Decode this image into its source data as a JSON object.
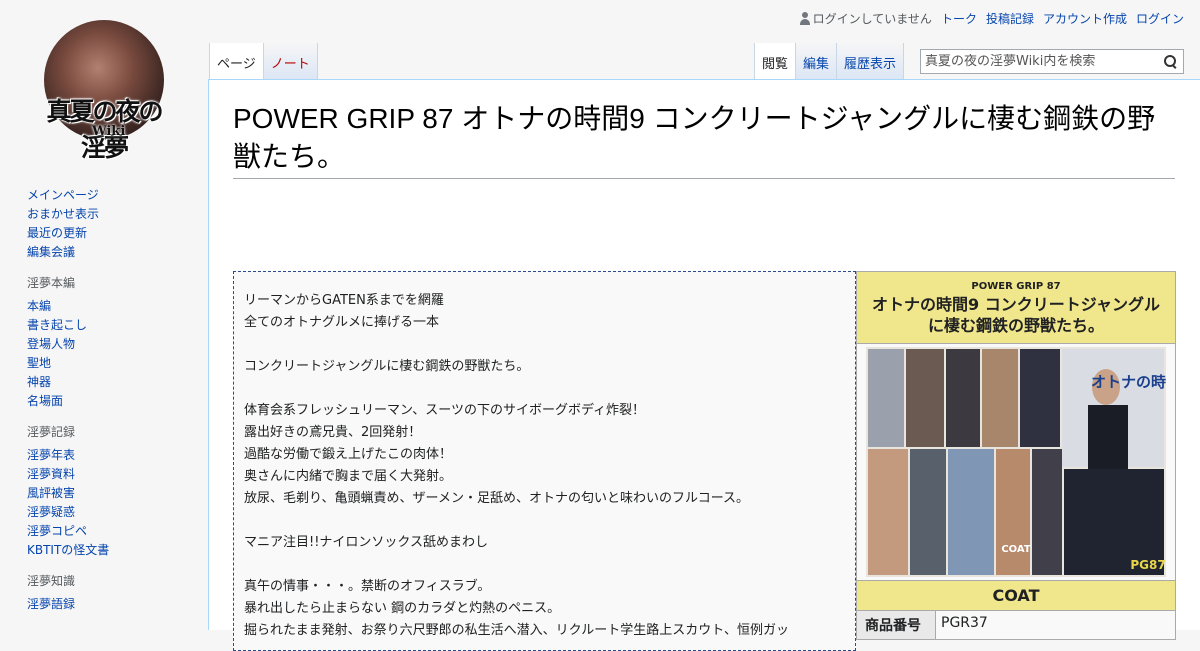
{
  "personal": {
    "not_logged_in": "ログインしていません",
    "links": [
      "トーク",
      "投稿記録",
      "アカウント作成",
      "ログイン"
    ]
  },
  "logo": {
    "text": "真夏の夜の淫夢",
    "sub": "Wiki"
  },
  "sidebar": {
    "nav": [
      "メインページ",
      "おまかせ表示",
      "最近の更新",
      "編集会議"
    ],
    "portals": [
      {
        "heading": "淫夢本編",
        "items": [
          "本編",
          "書き起こし",
          "登場人物",
          "聖地",
          "神器",
          "名場面"
        ]
      },
      {
        "heading": "淫夢記録",
        "items": [
          "淫夢年表",
          "淫夢資料",
          "風評被害",
          "淫夢疑惑",
          "淫夢コピペ",
          "KBTITの怪文書"
        ]
      },
      {
        "heading": "淫夢知識",
        "items": [
          "淫夢語録"
        ]
      }
    ]
  },
  "tabs": {
    "left": [
      {
        "label": "ページ",
        "state": "selected"
      },
      {
        "label": "ノート",
        "state": "new"
      }
    ],
    "right": [
      {
        "label": "閲覧",
        "state": "selected"
      },
      {
        "label": "編集",
        "state": "normal"
      },
      {
        "label": "履歴表示",
        "state": "normal"
      }
    ]
  },
  "search": {
    "placeholder": "真夏の夜の淫夢Wiki内を検索",
    "icon": "search-icon"
  },
  "page": {
    "title": "POWER GRIP 87 オトナの時間9 コンクリートジャングルに棲む鋼鉄の野獣たち。"
  },
  "description": [
    "リーマンからGATEN系までを網羅",
    "全てのオトナグルメに捧げる一本",
    "",
    "コンクリートジャングルに棲む鋼鉄の野獣たち。",
    "",
    "体育会系フレッシュリーマン、スーツの下のサイボーグボディ炸裂！",
    "露出好きの鳶兄貴、2回発射！",
    "過酷な労働で鍛え上げたこの肉体！",
    "奥さんに内緒で胸まで届く大発射。",
    "放尿、毛剃り、亀頭蝋責め、ザーメン・足舐め、オトナの匂いと味わいのフルコース。",
    "",
    "マニア注目!!ナイロンソックス舐めまわし",
    "",
    "真午の情事・・・。禁断のオフィスラブ。",
    "暴れ出したら止まらない 鋼のカラダと灼熱のペニス。",
    "掘られたまま発射、お祭り六尺野郎の私生活へ潜入、リクルート学生路上スカウト、恒例ガッ"
  ],
  "infobox": {
    "series": "POWER GRIP 87",
    "title": "オトナの時間9 コンクリートジャングルに棲む鋼鉄の野獣たち。",
    "maker": "COAT",
    "rows": [
      {
        "key": "商品番号",
        "value": "PGR37"
      }
    ],
    "cover": {
      "logo_text": "オトナの時間",
      "code": "PG87",
      "brand": "COAT"
    }
  },
  "colors": {
    "link": "#0645ad",
    "new_link": "#ba0000",
    "infobox_header": "#f0e68c",
    "border": "#a7d7f9"
  }
}
